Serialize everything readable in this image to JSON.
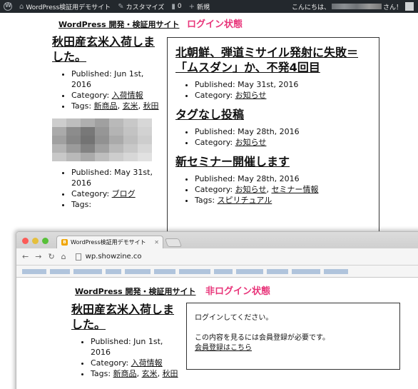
{
  "admin_bar": {
    "site_name": "WordPress検証用デモサイト",
    "customize": "カスタマイズ",
    "comments_count": "0",
    "new_label": "新規",
    "greeting": "こんにちは、",
    "greeting_suffix": "さん！"
  },
  "logged_in_view": {
    "site_title": "WordPress 開発・検証用サイト",
    "annotation": "ログイン状態",
    "left_posts": [
      {
        "title": "秋田産玄米入荷しました。",
        "published": "Published: Jun 1st, 2016",
        "category_label": "Category: ",
        "category": "入荷情報",
        "tags_label": "Tags: ",
        "tags": [
          "新商品",
          "玄米",
          "秋田"
        ]
      },
      {
        "published": "Published: May 31st, 2016",
        "category_label": "Category: ",
        "category": "ブログ",
        "tags_label": "Tags: "
      }
    ],
    "right_posts": [
      {
        "title": "北朝鮮、弾道ミサイル発射に失敗＝「ムスダン」か、不発4回目",
        "published": "Published: May 31st, 2016",
        "category_label": "Category: ",
        "category": "お知らせ"
      },
      {
        "title": "タグなし投稿",
        "published": "Published: May 28th, 2016",
        "category_label": "Category: ",
        "category": "お知らせ"
      },
      {
        "title": "新セミナー開催します",
        "published": "Published: May 28th, 2016",
        "category_label": "Category: ",
        "categories": [
          "お知らせ",
          "セミナー情報"
        ],
        "tags_label": "Tags: ",
        "tags": [
          "スピリチュアル"
        ]
      }
    ]
  },
  "browser": {
    "tab_title": "WordPress検証用デモサイト",
    "url": "wp.showzine.co",
    "colors": {
      "close": "#fc5b57",
      "minimize": "#e5bf3c",
      "maximize": "#57c038"
    }
  },
  "logged_out_view": {
    "site_title": "WordPress 開発・検証用サイト",
    "annotation": "非ログイン状態",
    "post": {
      "title": "秋田産玄米入荷しました。",
      "published": "Published: Jun 1st, 2016",
      "category_label": "Category: ",
      "category": "入荷情報",
      "tags_label": "Tags: ",
      "tags": [
        "新商品",
        "玄米",
        "秋田"
      ]
    },
    "notice": {
      "login_prompt": "ログインしてください。",
      "requirement": "この内容を見るには会員登録が必要です。",
      "register_link": "会員登録はこちら"
    }
  }
}
